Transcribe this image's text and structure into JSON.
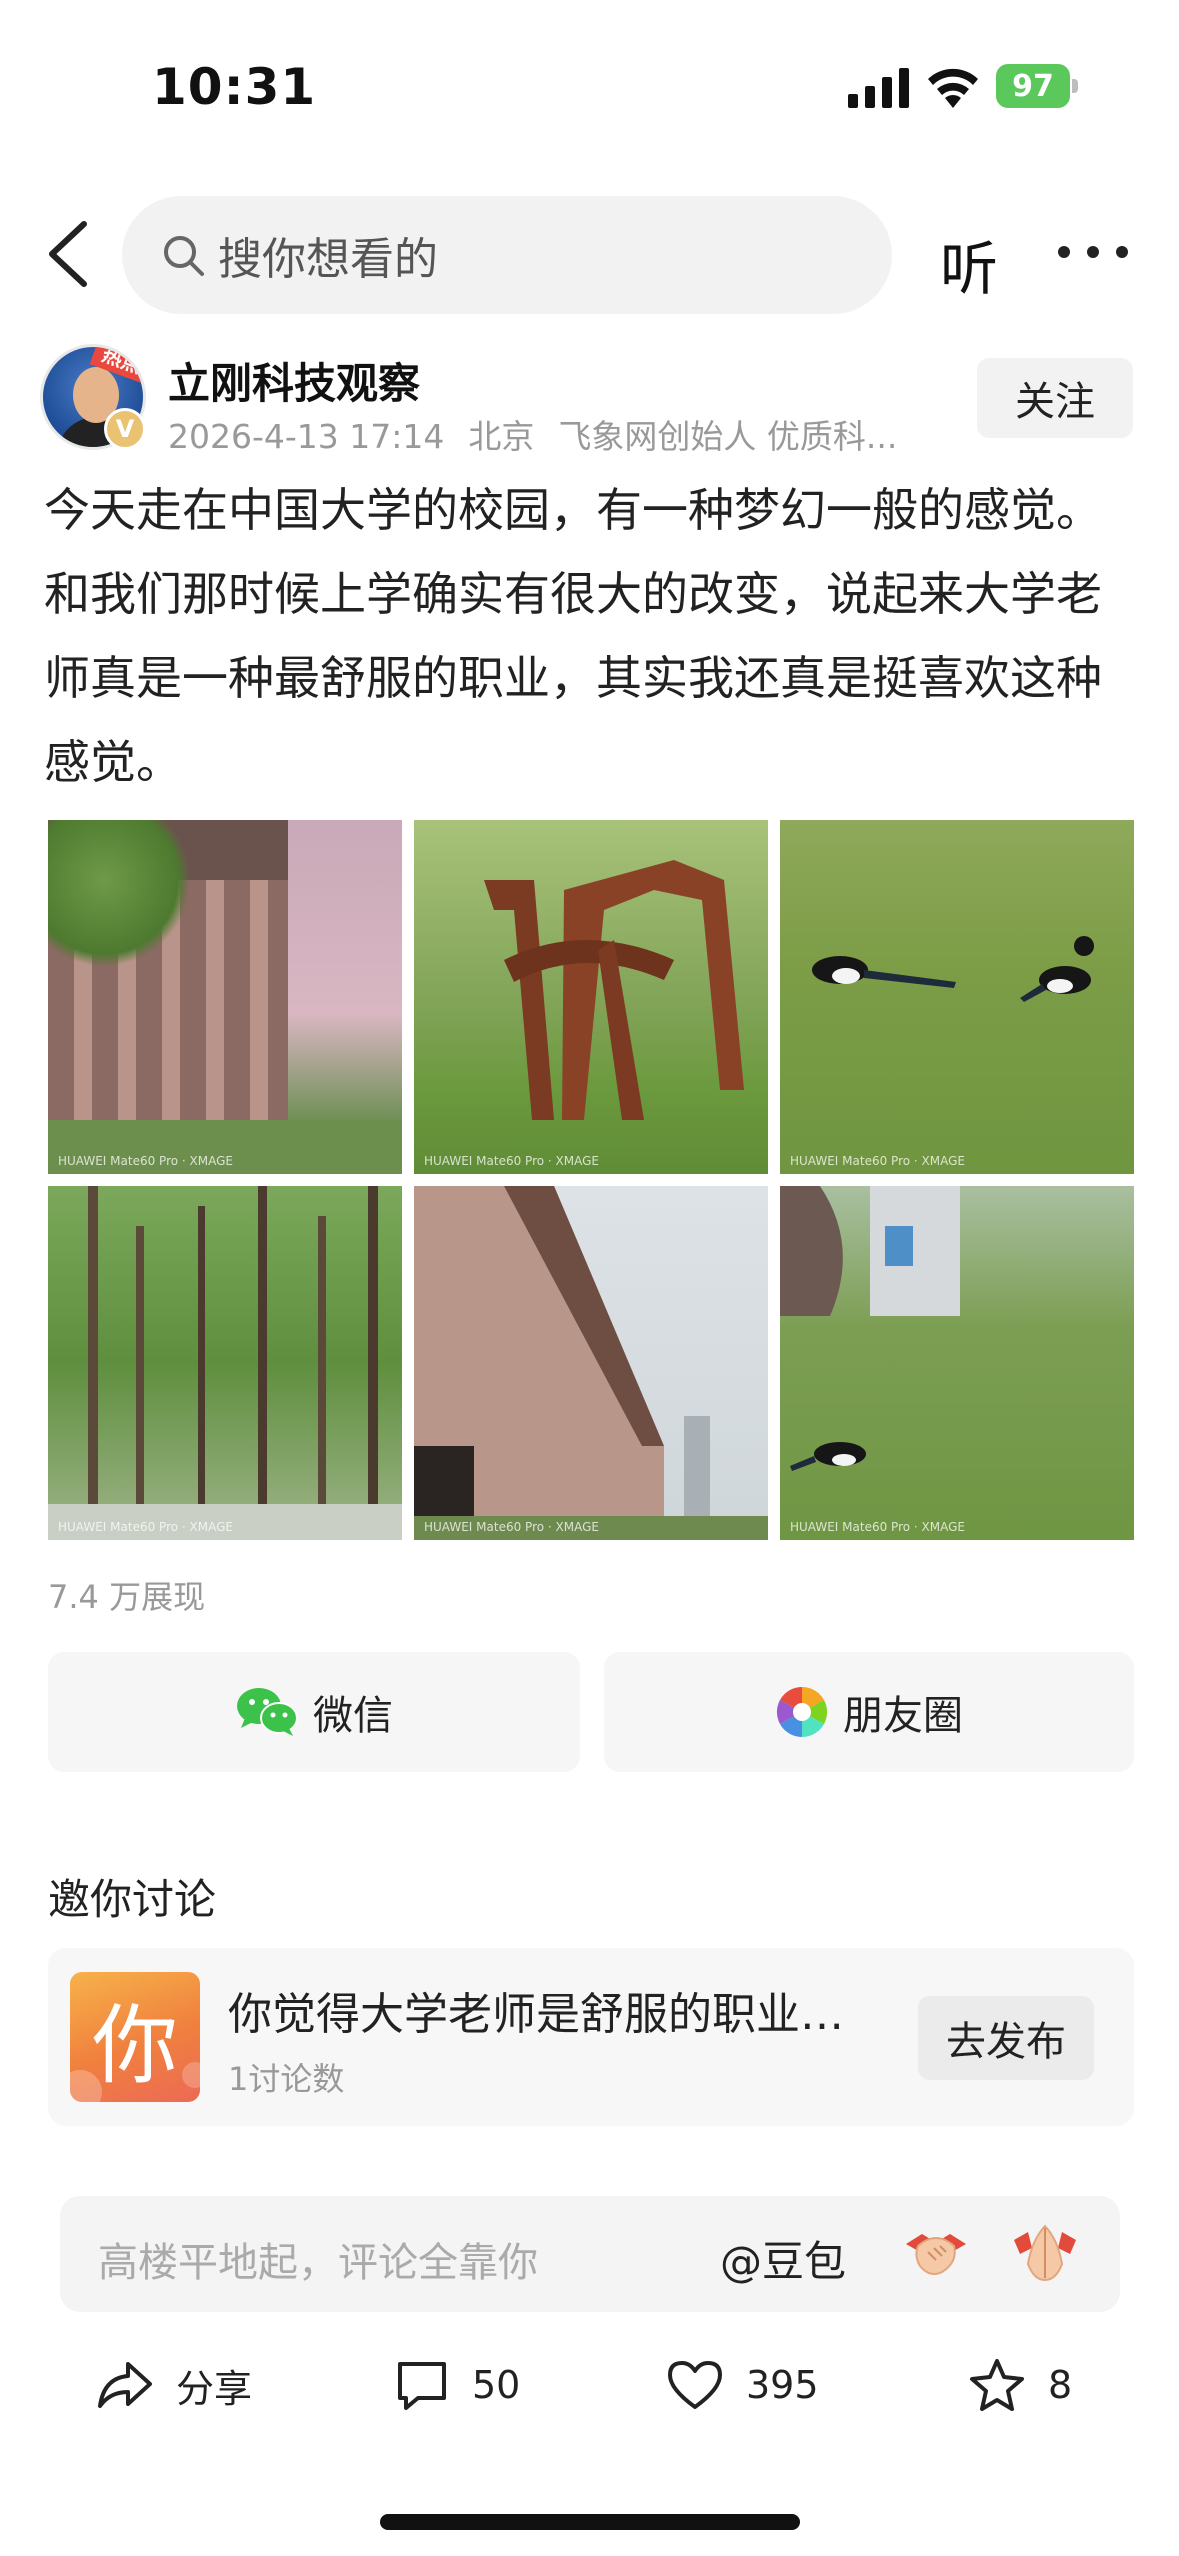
{
  "status_bar": {
    "time": "10:31",
    "battery_level": "97",
    "battery_color": "#5ac85a"
  },
  "nav": {
    "search_placeholder": "搜你想看的",
    "listen_label": "听"
  },
  "author": {
    "name": "立刚科技观察",
    "avatar_badge": "热点",
    "verified_mark": "V",
    "timestamp": "2026-4-13 17:14",
    "location": "北京",
    "description": "飞象网创始人 优质科...",
    "follow_label": "关注"
  },
  "post": {
    "text": "今天走在中国大学的校园，有一种梦幻一般的感觉。和我们那时候上学确实有很大的改变，说起来大学老师真是一种最舒服的职业，其实我还真是挺喜欢这种感觉。",
    "views": "7.4 万展现"
  },
  "share": {
    "wechat_label": "微信",
    "moments_label": "朋友圈",
    "wechat_color": "#3cc24a"
  },
  "discussion": {
    "section_title": "邀你讨论",
    "icon_char": "你",
    "title": "你觉得大学老师是舒服的职业吗？",
    "count": "1讨论数",
    "publish_label": "去发布"
  },
  "comment": {
    "placeholder": "高楼平地起，评论全靠你",
    "mention": "@豆包"
  },
  "actions": {
    "share_label": "分享",
    "comments": "50",
    "likes": "395",
    "favorites": "8"
  }
}
